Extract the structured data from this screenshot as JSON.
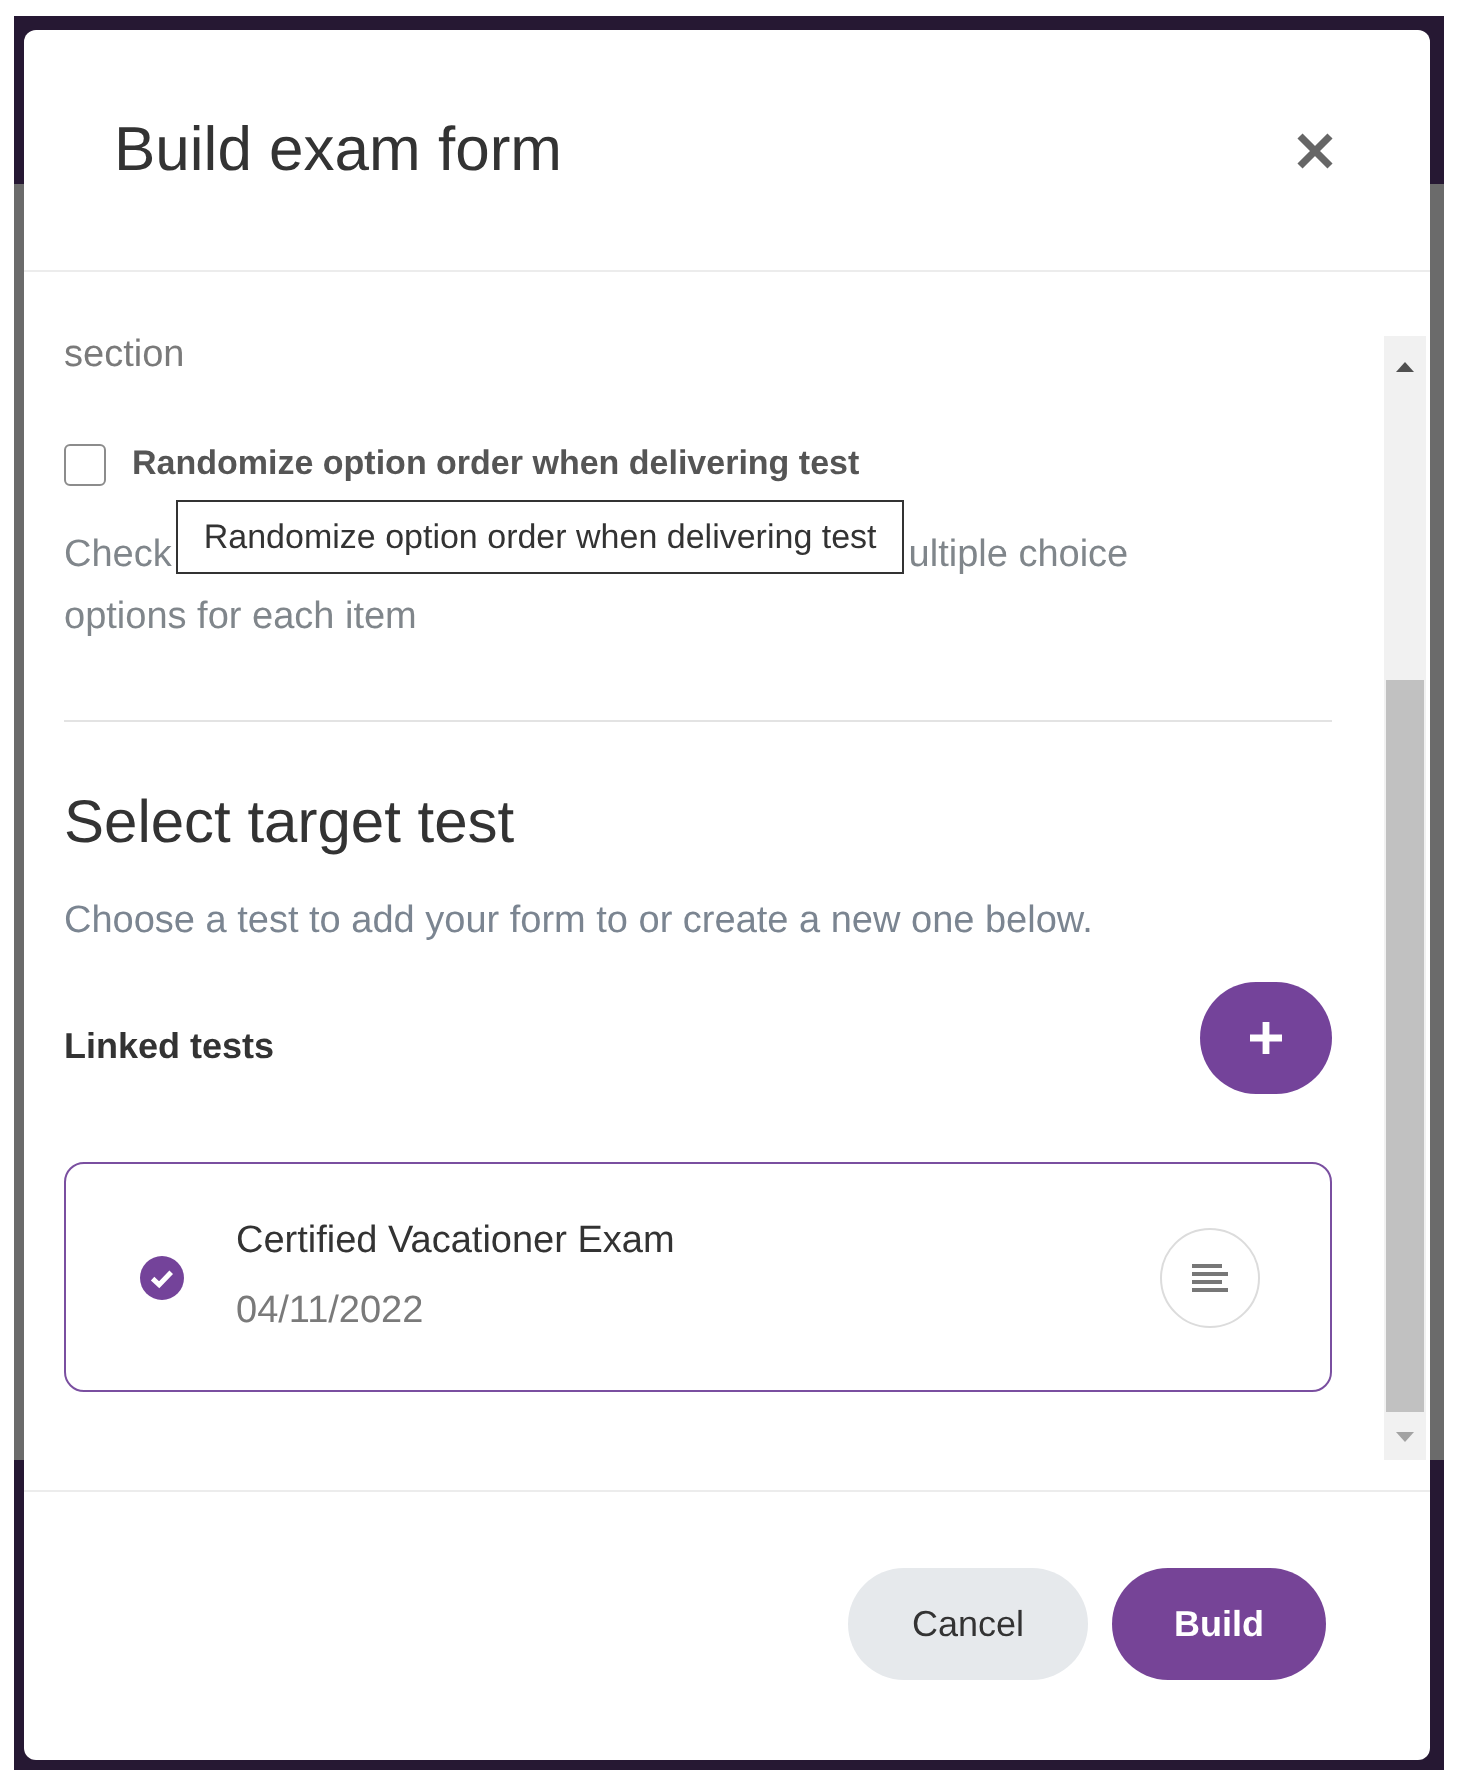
{
  "dialog": {
    "title": "Build exam form"
  },
  "options": {
    "preceding_text": "section",
    "checkbox": {
      "label": "Randomize option order when delivering test",
      "checked": false
    },
    "tooltip": "Randomize option order when delivering test",
    "description": {
      "line_1_start": "Check",
      "line_1_end": "ultiple choice",
      "line_2": "options for each item"
    }
  },
  "target": {
    "heading": "Select target test",
    "subtitle": "Choose a test to add your form to or create a new one below.",
    "linked_label": "Linked tests",
    "linked_tests": [
      {
        "name": "Certified Vacationer Exam",
        "date": "04/11/2022",
        "selected": true
      }
    ]
  },
  "footer": {
    "buttons": [
      {
        "label": "Cancel",
        "kind": "secondary"
      },
      {
        "label": "Build",
        "kind": "primary"
      }
    ]
  }
}
